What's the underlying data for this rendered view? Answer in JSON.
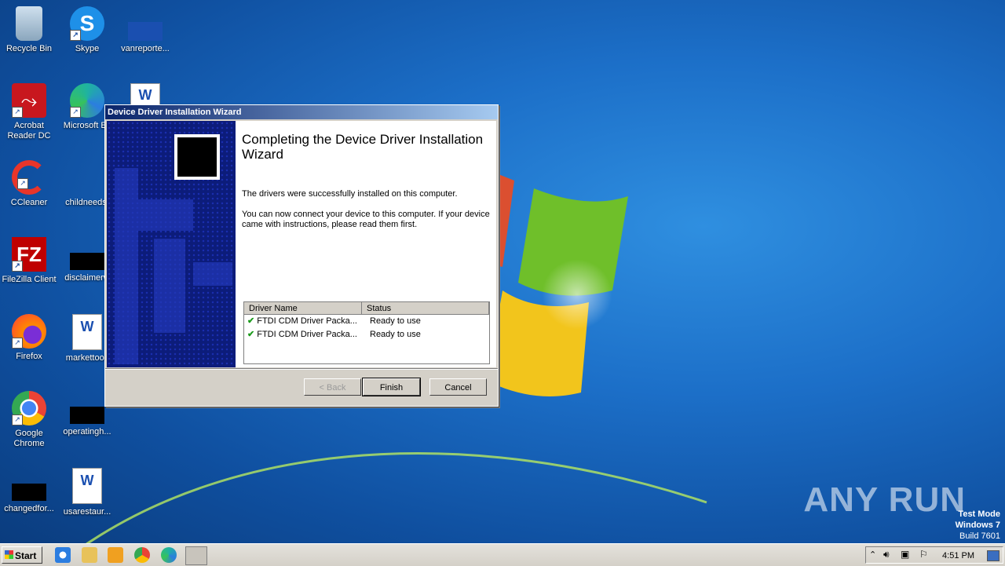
{
  "desktop": {
    "icons": [
      {
        "label": "Recycle Bin",
        "icon": "recycle-bin-icon"
      },
      {
        "label": "Skype",
        "icon": "skype-icon"
      },
      {
        "label": "vanreporte...",
        "icon": "file-icon"
      },
      {
        "label": "Acrobat Reader DC",
        "icon": "acrobat-icon"
      },
      {
        "label": "Microsoft Ec",
        "icon": "edge-icon"
      },
      {
        "label": "",
        "icon": "word-doc-icon"
      },
      {
        "label": "CCleaner",
        "icon": "ccleaner-icon"
      },
      {
        "label": "childneeds.",
        "icon": "file-icon"
      },
      {
        "label": "FileZilla Client",
        "icon": "filezilla-icon"
      },
      {
        "label": "disclaimerw",
        "icon": "file-icon"
      },
      {
        "label": "Firefox",
        "icon": "firefox-icon"
      },
      {
        "label": "markettool.",
        "icon": "word-doc-icon"
      },
      {
        "label": "Google Chrome",
        "icon": "chrome-icon"
      },
      {
        "label": "operatingh...",
        "icon": "file-icon"
      },
      {
        "label": "changedfor...",
        "icon": "file-icon"
      },
      {
        "label": "usarestaur...",
        "icon": "word-doc-icon"
      }
    ]
  },
  "wizard": {
    "title": "Device Driver Installation Wizard",
    "heading": "Completing the Device Driver Installation Wizard",
    "p1": "The drivers were successfully installed on this computer.",
    "p2": "You can now connect your device to this computer. If your device came with instructions, please read them first.",
    "columns": [
      "Driver Name",
      "Status"
    ],
    "rows": [
      {
        "name": "FTDI CDM Driver Packa...",
        "status": "Ready to use"
      },
      {
        "name": "FTDI CDM Driver Packa...",
        "status": "Ready to use"
      }
    ],
    "back_label": "< Back",
    "finish_label": "Finish",
    "cancel_label": "Cancel"
  },
  "watermark": {
    "brand": "ANY RUN",
    "line1": "Test Mode",
    "line2": "Windows 7",
    "line3": "Build 7601"
  },
  "taskbar": {
    "start_label": "Start",
    "clock": "4:51 PM",
    "pinned": [
      "ie-icon",
      "explorer-icon",
      "media-player-icon",
      "chrome-icon",
      "edge-icon",
      "driver-installer-icon"
    ]
  }
}
